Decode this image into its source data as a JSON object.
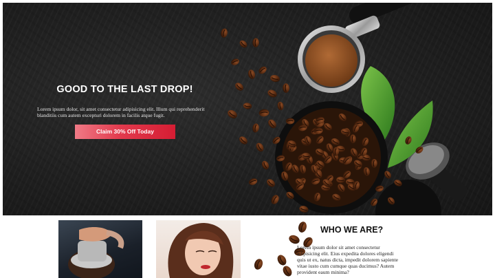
{
  "hero": {
    "heading": "GOOD TO THE LAST DROP!",
    "body": "Lorem ipsum dolor, sit amet consectetur adipisicing elit. Illum qui reprehenderit blanditiis cum autem excepturi dolorem in facilis atque fugit.",
    "cta_label": "Claim 30% Off Today"
  },
  "about": {
    "title": "WHO WE ARE?",
    "body": "Lorem ipsum dolor sit amet consectetur adipisicing elit. Eius expedita dolores eligendi quis ut ex, natus dicta, impedit dolorem sapiente vitae iusto cum cumque quas ducimus? Autem provident eaum minima?"
  },
  "colors": {
    "hero_bg": "#1f1f1f",
    "accent": "#d51d33",
    "text_light": "#ffffff",
    "text_dark": "#111111"
  },
  "images": {
    "hero": "coffee-beans-bowl-portafilter-image",
    "thumb_1": "barista-pouring-milk-image",
    "thumb_2": "woman-portrait-image",
    "about_decor": "coffee-beans-decor-image"
  }
}
